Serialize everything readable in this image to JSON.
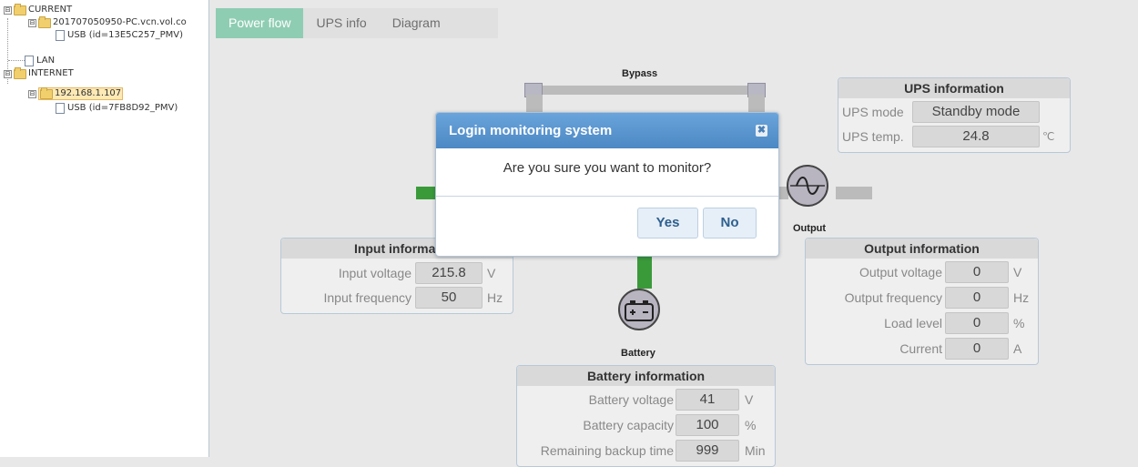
{
  "tree": {
    "current_label": "CURRENT",
    "pc_label": "201707050950-PC.vcn.vol.co",
    "usb1_label": "USB (id=13E5C257_PMV)",
    "lan_label": "LAN",
    "internet_label": "INTERNET",
    "ip_label": "192.168.1.107",
    "usb2_label": "USB (id=7FB8D92_PMV)",
    "toggle_minus": "⊟"
  },
  "tabs": {
    "power_flow": "Power flow",
    "ups_info": "UPS info",
    "diagram": "Diagram"
  },
  "diagram": {
    "bypass_label": "Bypass",
    "output_label": "Output",
    "battery_label": "Battery"
  },
  "ups_info": {
    "title": "UPS information",
    "mode_label": "UPS mode",
    "mode_value": "Standby mode",
    "temp_label": "UPS temp.",
    "temp_value": "24.8",
    "temp_unit": "℃"
  },
  "input_info": {
    "title": "Input informat",
    "voltage_label": "Input voltage",
    "voltage_value": "215.8",
    "voltage_unit": "V",
    "freq_label": "Input frequency",
    "freq_value": "50",
    "freq_unit": "Hz"
  },
  "output_info": {
    "title": "Output information",
    "voltage_label": "Output voltage",
    "voltage_value": "0",
    "voltage_unit": "V",
    "freq_label": "Output frequency",
    "freq_value": "0",
    "freq_unit": "Hz",
    "load_label": "Load level",
    "load_value": "0",
    "load_unit": "%",
    "current_label": "Current",
    "current_value": "0",
    "current_unit": "A"
  },
  "battery_info": {
    "title": "Battery information",
    "voltage_label": "Battery voltage",
    "voltage_value": "41",
    "voltage_unit": "V",
    "capacity_label": "Battery capacity",
    "capacity_value": "100",
    "capacity_unit": "%",
    "backup_label": "Remaining backup time",
    "backup_value": "999",
    "backup_unit": "Min"
  },
  "dialog": {
    "title": "Login monitoring system",
    "close_glyph": "✖",
    "message": "Are you sure you want to monitor?",
    "yes_label": "Yes",
    "no_label": "No"
  },
  "colors": {
    "tab_active": "#8fcdb3",
    "dialog_header": "#5b97cf",
    "flow_active": "#3a9a3a",
    "flow_inactive": "#bbbbbb"
  }
}
